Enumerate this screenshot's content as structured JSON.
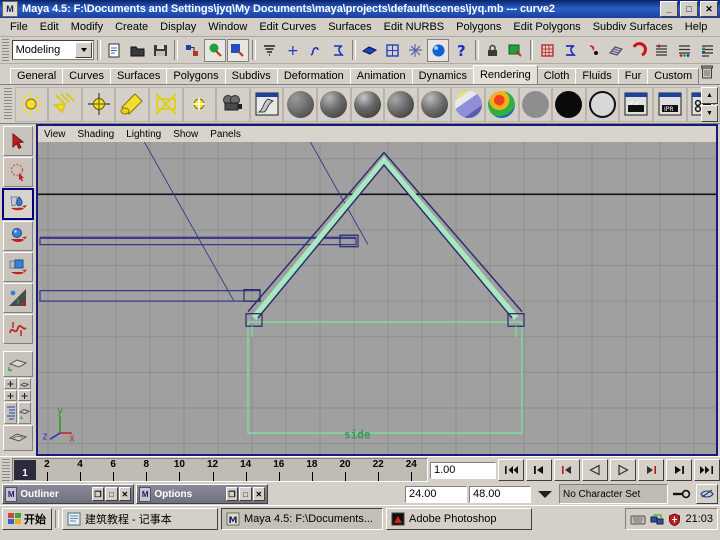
{
  "window": {
    "title": "Maya 4.5: F:\\Documents and Settings\\jyq\\My Documents\\maya\\projects\\default\\scenes\\jyq.mb  ---  curve2",
    "app_icon": "maya-icon",
    "minimize": "_",
    "maximize": "□",
    "close": "✕"
  },
  "menubar": {
    "items": [
      "File",
      "Edit",
      "Modify",
      "Create",
      "Display",
      "Window",
      "Edit Curves",
      "Surfaces",
      "Edit NURBS",
      "Polygons",
      "Edit Polygons",
      "Subdiv Surfaces",
      "Help"
    ]
  },
  "statusline": {
    "mode": "Modeling",
    "buttons": [
      {
        "name": "new-scene-button",
        "icon": "document-icon"
      },
      {
        "name": "open-scene-button",
        "icon": "folder-icon"
      },
      {
        "name": "save-scene-button",
        "icon": "floppy-icon"
      },
      {
        "name": "select-hierarchy-button",
        "icon": "hierarchy-icon"
      },
      {
        "name": "select-object-button",
        "icon": "object-icon"
      },
      {
        "name": "select-component-button",
        "icon": "component-icon"
      },
      {
        "name": "snap-grid-button",
        "icon": "grid-snap-icon"
      },
      {
        "name": "snap-curve-button",
        "icon": "curve-snap-icon"
      },
      {
        "name": "snap-point-button",
        "icon": "point-snap-icon"
      },
      {
        "name": "construction-plane-button",
        "icon": "plane-snap-icon"
      },
      {
        "name": "make-live-button",
        "icon": "magnet-icon"
      },
      {
        "name": "attribute-editor-button",
        "icon": "attribute-icon"
      },
      {
        "name": "channel-box-button",
        "icon": "channelbox-icon"
      },
      {
        "name": "layer-editor-button",
        "icon": "layer-icon"
      }
    ]
  },
  "shelf": {
    "tabs": [
      "General",
      "Curves",
      "Surfaces",
      "Polygons",
      "Subdivs",
      "Deformation",
      "Animation",
      "Dynamics",
      "Rendering",
      "Cloth",
      "Fluids",
      "Fur",
      "Custom"
    ],
    "active_tab": "Rendering",
    "trash_icon": "trash-icon",
    "scroll_up_icon": "▲",
    "scroll_down_icon": "▼",
    "items": [
      {
        "name": "ambient-light",
        "icon": "ambient-light-icon"
      },
      {
        "name": "directional-light",
        "icon": "directional-light-icon"
      },
      {
        "name": "point-light",
        "icon": "point-light-icon"
      },
      {
        "name": "spot-light",
        "icon": "spot-light-icon"
      },
      {
        "name": "area-light",
        "icon": "area-light-icon"
      },
      {
        "name": "volume-light",
        "icon": "volume-light-icon"
      },
      {
        "name": "create-camera",
        "icon": "camera-icon"
      },
      {
        "name": "render-view",
        "icon": "render-view-icon"
      },
      {
        "name": "lambert-material",
        "icon": "sphere-lambert-icon"
      },
      {
        "name": "blinn-material",
        "icon": "sphere-blinn-icon"
      },
      {
        "name": "phong-material",
        "icon": "sphere-phong-icon"
      },
      {
        "name": "anisotropic-material",
        "icon": "sphere-aniso-icon"
      },
      {
        "name": "ramp-shader",
        "icon": "sphere-ramp-icon"
      },
      {
        "name": "ramp-texture",
        "icon": "sphere-ramp-color-icon"
      },
      {
        "name": "surface-shader",
        "icon": "sphere-flat-icon"
      },
      {
        "name": "use-background",
        "icon": "sphere-black-icon"
      },
      {
        "name": "layered-shader",
        "icon": "sphere-outline-icon"
      },
      {
        "name": "render-current-frame",
        "icon": "clapper-icon"
      },
      {
        "name": "ipr-render",
        "icon": "clapper-ipr-icon"
      },
      {
        "name": "render-globals",
        "icon": "render-globals-icon"
      }
    ]
  },
  "toolbox": {
    "tools": [
      {
        "name": "select-tool",
        "icon": "arrow-cursor-icon",
        "selected": false
      },
      {
        "name": "lasso-tool",
        "icon": "lasso-icon",
        "selected": false
      },
      {
        "name": "move-tool",
        "icon": "move-paint-icon",
        "selected": true
      },
      {
        "name": "rotate-tool",
        "icon": "rotate-icon",
        "selected": false
      },
      {
        "name": "scale-tool",
        "icon": "scale-icon",
        "selected": false
      },
      {
        "name": "universal-manipulator",
        "icon": "manipulator-icon",
        "selected": false
      },
      {
        "name": "soft-modification-tool",
        "icon": "soft-mod-icon",
        "selected": false
      }
    ],
    "layouts": [
      {
        "name": "single-perspective-layout",
        "icon": "single-view-icon"
      },
      {
        "name": "four-view-layout",
        "icon": "four-view-icon"
      },
      {
        "name": "outliner-persp-layout",
        "icon": "outliner-persp-icon"
      },
      {
        "name": "hypergraph-layout",
        "icon": "hypergraph-icon"
      }
    ]
  },
  "viewport": {
    "panel_menu": [
      "View",
      "Shading",
      "Lighting",
      "Show",
      "Panels"
    ],
    "view_label": "side",
    "axis": {
      "x": "x",
      "y": "y",
      "z": "z",
      "x_color": "#c03030",
      "y_color": "#20a020",
      "z_color": "#3030c0"
    },
    "background_color": "#a0a0a0",
    "grid_color": "#8e8e8e",
    "axis_line_color": "#101018",
    "curve_color": "#2b2b6b",
    "selected_color": "#9fe0b0",
    "highlight_border": "#1a1a7a"
  },
  "timeline": {
    "ticks": [
      2,
      4,
      6,
      8,
      10,
      12,
      14,
      16,
      18,
      20,
      22,
      24
    ],
    "current_frame": "1",
    "current_time_field": "1.00",
    "range_start": "24.00",
    "range_end": "48.00",
    "character_set": "No Character Set",
    "playback_buttons": [
      {
        "name": "go-to-start-button",
        "icon": "skip-start-icon"
      },
      {
        "name": "step-back-keyframe-button",
        "icon": "prev-key-icon"
      },
      {
        "name": "step-back-frame-button",
        "icon": "prev-frame-icon"
      },
      {
        "name": "play-backwards-button",
        "icon": "play-back-icon"
      },
      {
        "name": "play-forwards-button",
        "icon": "play-forward-icon"
      },
      {
        "name": "step-forward-frame-button",
        "icon": "next-frame-icon"
      },
      {
        "name": "step-forward-keyframe-button",
        "icon": "next-key-icon"
      },
      {
        "name": "go-to-end-button",
        "icon": "skip-end-icon"
      }
    ],
    "auto_key_icon": "key-icon",
    "animation_prefs_icon": "anim-prefs-icon",
    "character_dropdown_icon": "▼"
  },
  "mdi_windows": [
    {
      "name": "outliner-window",
      "title": "Outliner",
      "icon": "maya-icon",
      "restore": "❐",
      "maximize": "□",
      "close": "✕"
    },
    {
      "name": "options-window",
      "title": "Options",
      "icon": "maya-icon",
      "restore": "❐",
      "maximize": "□",
      "close": "✕"
    }
  ],
  "taskbar": {
    "start_label": "开始",
    "items": [
      {
        "name": "taskbar-item-notepad",
        "label": "建筑教程 - 记事本",
        "icon": "notepad-icon",
        "active": false
      },
      {
        "name": "taskbar-item-maya",
        "label": "Maya 4.5: F:\\Documents...",
        "icon": "maya-icon",
        "active": true
      },
      {
        "name": "taskbar-item-photoshop",
        "label": "Adobe Photoshop",
        "icon": "photoshop-icon",
        "active": false
      }
    ],
    "tray": {
      "ime_icon": "keyboard-icon",
      "network_icon": "network-icon",
      "antivirus_icon": "shield-icon",
      "clock": "21:03"
    }
  }
}
